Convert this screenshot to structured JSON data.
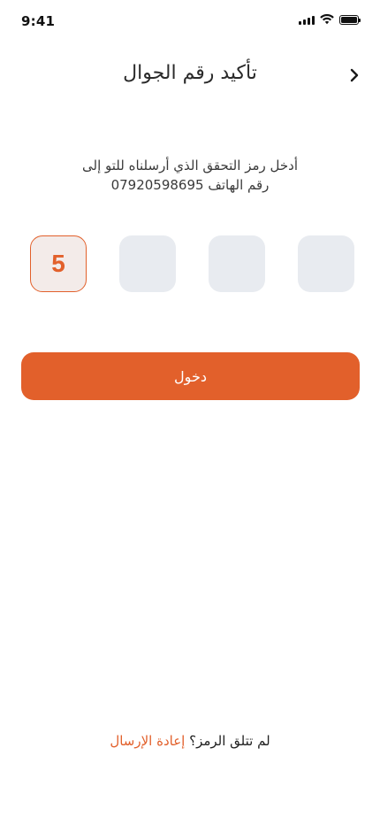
{
  "status_bar": {
    "time": "9:41",
    "icons": [
      "signal-icon",
      "wifi-icon",
      "battery-icon"
    ]
  },
  "header": {
    "title": "تأكيد رقم الجوال",
    "back_icon": "chevron-right-icon"
  },
  "instruction": {
    "line1": "أدخل رمز التحقق الذي أرسلناه للتو إلى",
    "line2_prefix": "رقم الهاتف",
    "phone": "07920598695"
  },
  "otp": {
    "digits": [
      "5",
      "",
      "",
      ""
    ]
  },
  "login_button": {
    "label": "دخول"
  },
  "resend": {
    "question": "لم تتلق الرمز؟",
    "link": "إعادة الإرسال"
  },
  "colors": {
    "accent": "#e2602b",
    "box_bg": "#e8ebf0",
    "text": "#2b2b2b"
  }
}
